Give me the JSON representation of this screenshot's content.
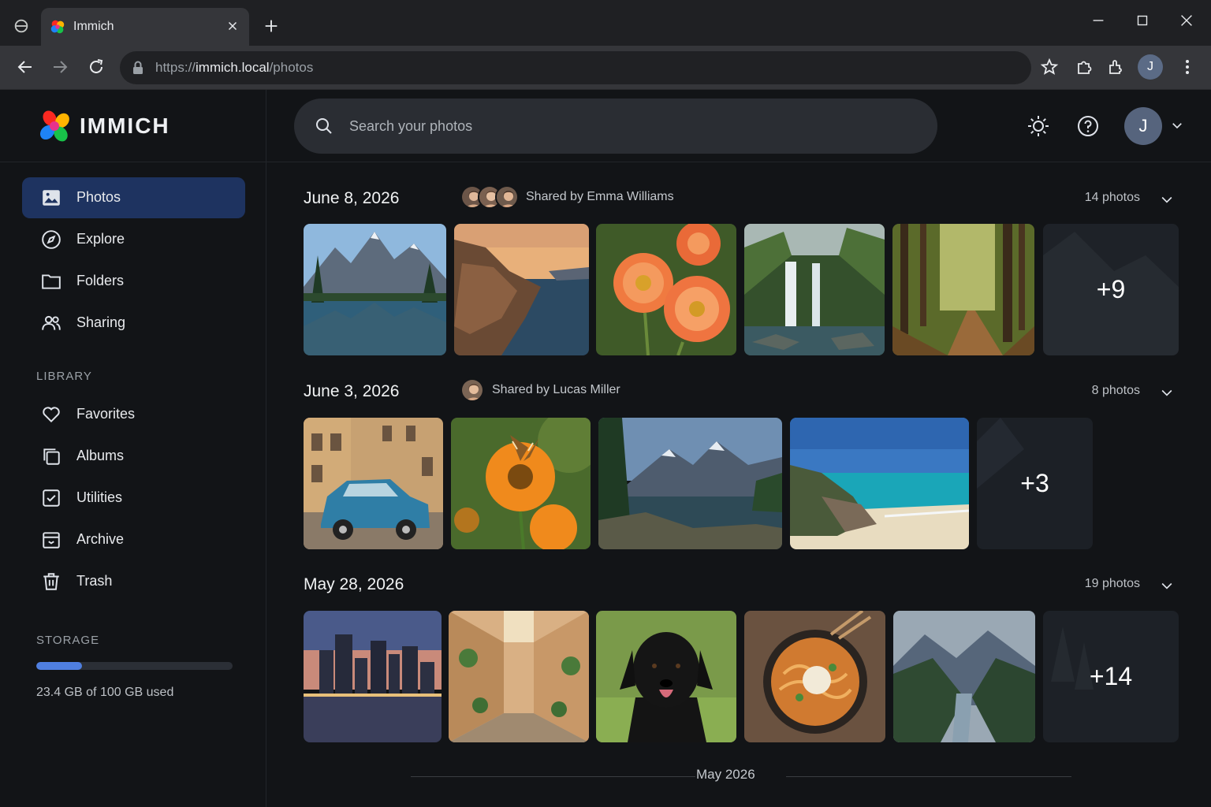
{
  "browser": {
    "tab_title": "Immich",
    "url_prefix": "https://",
    "url_host": "immich.local",
    "url_path": "/photos",
    "profile_initial": "J"
  },
  "brand": {
    "name": "IMMICH"
  },
  "sidebar": {
    "items": [
      {
        "label": "Photos",
        "icon": "photos-icon",
        "active": true
      },
      {
        "label": "Explore",
        "icon": "compass-icon"
      },
      {
        "label": "Folders",
        "icon": "folder-icon"
      },
      {
        "label": "Sharing",
        "icon": "people-icon"
      }
    ],
    "library_heading": "LIBRARY",
    "library_items": [
      {
        "label": "Favorites",
        "icon": "heart-icon"
      },
      {
        "label": "Albums",
        "icon": "albums-icon"
      },
      {
        "label": "Utilities",
        "icon": "checkbox-icon"
      },
      {
        "label": "Archive",
        "icon": "archive-icon"
      },
      {
        "label": "Trash",
        "icon": "trash-icon"
      }
    ],
    "storage_heading": "STORAGE",
    "storage_used_fraction": 0.234,
    "storage_text": "23.4 GB of 100 GB used"
  },
  "search": {
    "placeholder": "Search your photos"
  },
  "user": {
    "initial": "J"
  },
  "groups": [
    {
      "date": "June 8, 2026",
      "shared_by": "Shared by Emma Williams",
      "count": "14 photos",
      "thumbnails": [
        "mountain-lake",
        "coastal-village-sunset",
        "orange-dahlias",
        "waterfall",
        "forest-path"
      ],
      "more": "+9"
    },
    {
      "date": "June 3, 2026",
      "shared_by": "Shared by Lucas Miller",
      "count": "8 photos",
      "thumbnails": [
        "blue-vintage-car",
        "butterfly-on-flower",
        "mountain-river",
        "tropical-beach"
      ],
      "more": "+3"
    },
    {
      "date": "May 28, 2026",
      "count": "19 photos",
      "thumbnails": [
        "city-skyline-night",
        "narrow-alley",
        "black-labrador",
        "noodle-bowl",
        "misty-valley"
      ],
      "more": "+14"
    }
  ],
  "month_divider": "May 2026",
  "colors": {
    "accent": "#4f7fe0",
    "active_nav": "#1e3360",
    "background": "#121417"
  }
}
